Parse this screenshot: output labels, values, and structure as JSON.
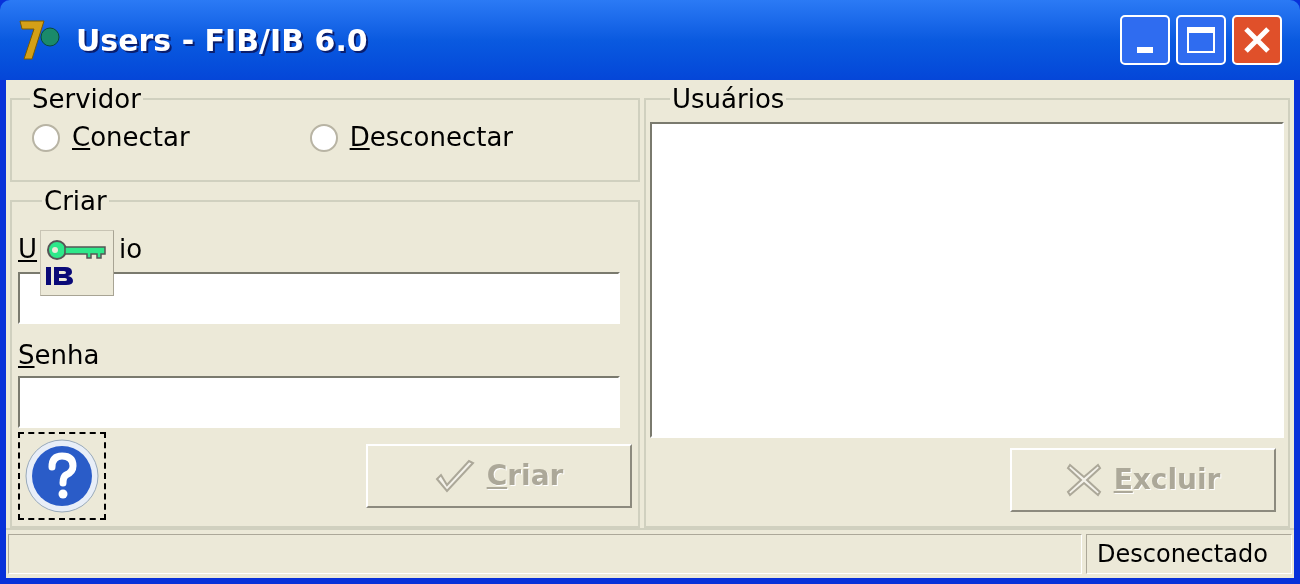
{
  "window": {
    "title": "Users - FIB/IB 6.0"
  },
  "servidor": {
    "legend": "Servidor",
    "options": [
      {
        "label": "Conectar",
        "selected": false
      },
      {
        "label": "Desconectar",
        "selected": false
      }
    ]
  },
  "criar": {
    "legend": "Criar",
    "usuario_label_start": "U",
    "usuario_label_end": "io",
    "senha_label": "Senha",
    "button": {
      "label": "Criar",
      "disabled": true
    }
  },
  "usuarios": {
    "legend": "Usuários",
    "button": {
      "label": "Excluir",
      "disabled": true
    }
  },
  "status_bar": {
    "panels": [
      "Desconectado"
    ]
  }
}
